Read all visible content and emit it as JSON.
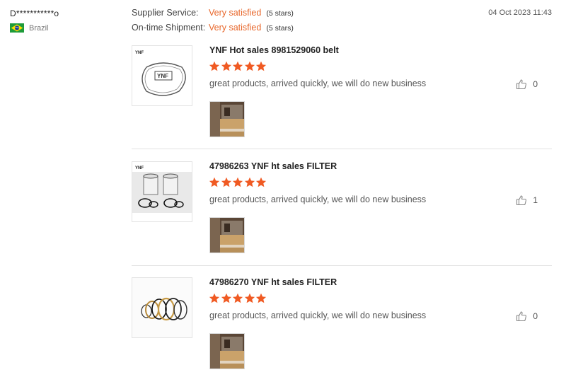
{
  "reviewer": {
    "name": "D***********o",
    "country": "Brazil",
    "flag_icon": "brazil-flag-icon"
  },
  "ratings": [
    {
      "label": "Supplier Service:",
      "value": "Very satisfied",
      "stars_text": "(5 stars)"
    },
    {
      "label": "On-time Shipment:",
      "value": "Very satisfied",
      "stars_text": "(5 stars)"
    }
  ],
  "date": "04 Oct 2023 11:43",
  "items": [
    {
      "title": "YNF Hot sales 8981529060 belt",
      "rating": 5,
      "comment": "great products, arrived quickly, we will do new business",
      "likes": "0",
      "thumb_icon": "belt-product-image",
      "photo_icon": "customer-photo"
    },
    {
      "title": "47986263 YNF ht sales FILTER",
      "rating": 5,
      "comment": "great products, arrived quickly, we will do new business",
      "likes": "1",
      "thumb_icon": "filter-product-image",
      "photo_icon": "customer-photo"
    },
    {
      "title": "47986270 YNF ht sales FILTER",
      "rating": 5,
      "comment": "great products, arrived quickly, we will do new business",
      "likes": "0",
      "thumb_icon": "seal-kit-product-image",
      "photo_icon": "customer-photo"
    }
  ],
  "colors": {
    "accent": "#e8672b",
    "star": "#f05a23",
    "separator": "#e3e3e3"
  }
}
